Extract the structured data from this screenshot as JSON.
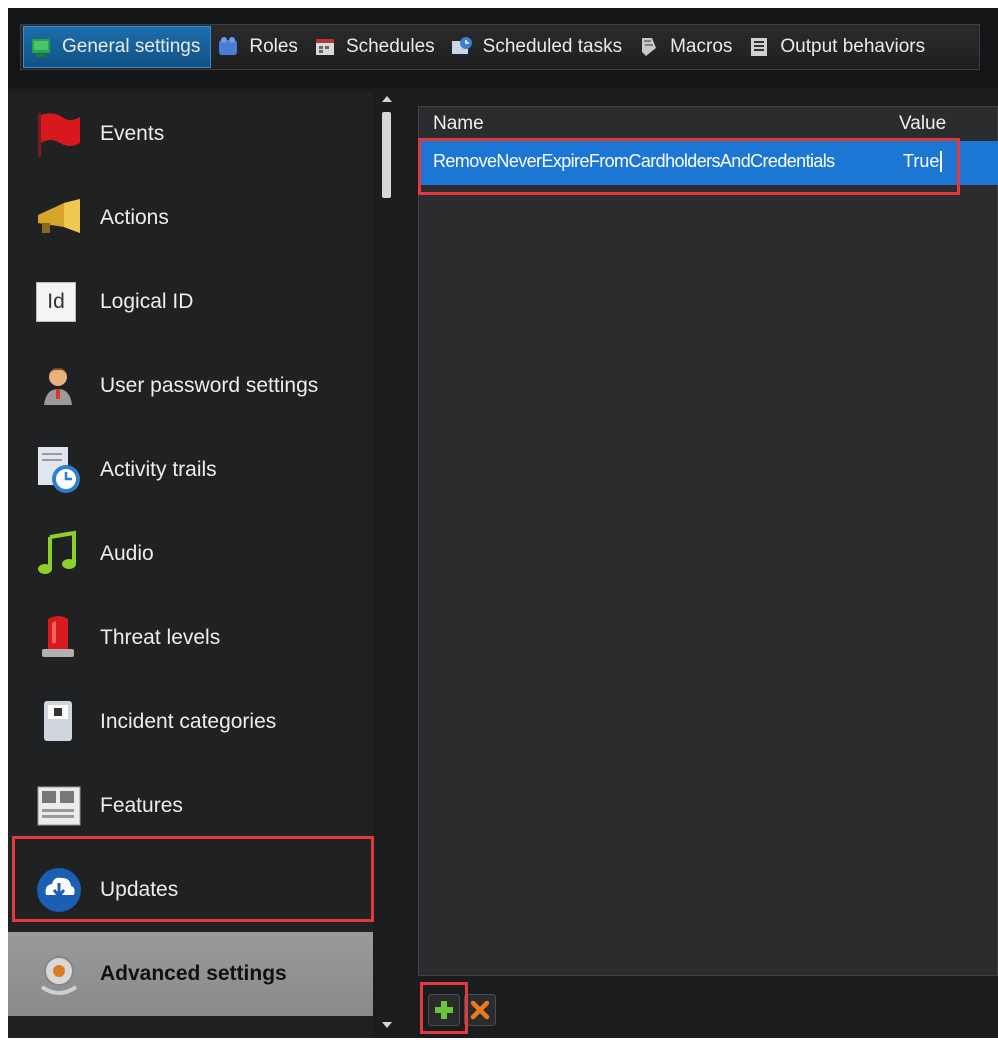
{
  "tabs": [
    {
      "label": "General settings",
      "icon": "general-settings-icon",
      "active": true
    },
    {
      "label": "Roles",
      "icon": "roles-icon",
      "active": false
    },
    {
      "label": "Schedules",
      "icon": "schedules-icon",
      "active": false
    },
    {
      "label": "Scheduled tasks",
      "icon": "scheduled-tasks-icon",
      "active": false
    },
    {
      "label": "Macros",
      "icon": "macros-icon",
      "active": false
    },
    {
      "label": "Output behaviors",
      "icon": "output-behaviors-icon",
      "active": false
    }
  ],
  "sidebar": {
    "items": [
      {
        "label": "Events",
        "icon": "red-flag-icon"
      },
      {
        "label": "Actions",
        "icon": "megaphone-icon"
      },
      {
        "label": "Logical ID",
        "icon": "id-badge-icon",
        "icon_text": "Id"
      },
      {
        "label": "User password settings",
        "icon": "user-icon"
      },
      {
        "label": "Activity trails",
        "icon": "activity-clock-icon"
      },
      {
        "label": "Audio",
        "icon": "music-note-icon"
      },
      {
        "label": "Threat levels",
        "icon": "threat-light-icon"
      },
      {
        "label": "Incident categories",
        "icon": "incident-icon"
      },
      {
        "label": "Features",
        "icon": "features-icon"
      },
      {
        "label": "Updates",
        "icon": "cloud-download-icon"
      },
      {
        "label": "Advanced settings",
        "icon": "advanced-settings-gear-icon",
        "selected": true
      }
    ]
  },
  "grid": {
    "columns": {
      "name": "Name",
      "value": "Value"
    },
    "rows": [
      {
        "name": "RemoveNeverExpireFromCardholdersAndCredentials",
        "value": "True",
        "selected": true
      }
    ]
  },
  "toolbar": {
    "add": "add-icon",
    "delete": "delete-icon"
  },
  "colors": {
    "selection_blue": "#1c77d4",
    "highlight_red": "#e0393e",
    "active_tab": "#1d6dab"
  }
}
